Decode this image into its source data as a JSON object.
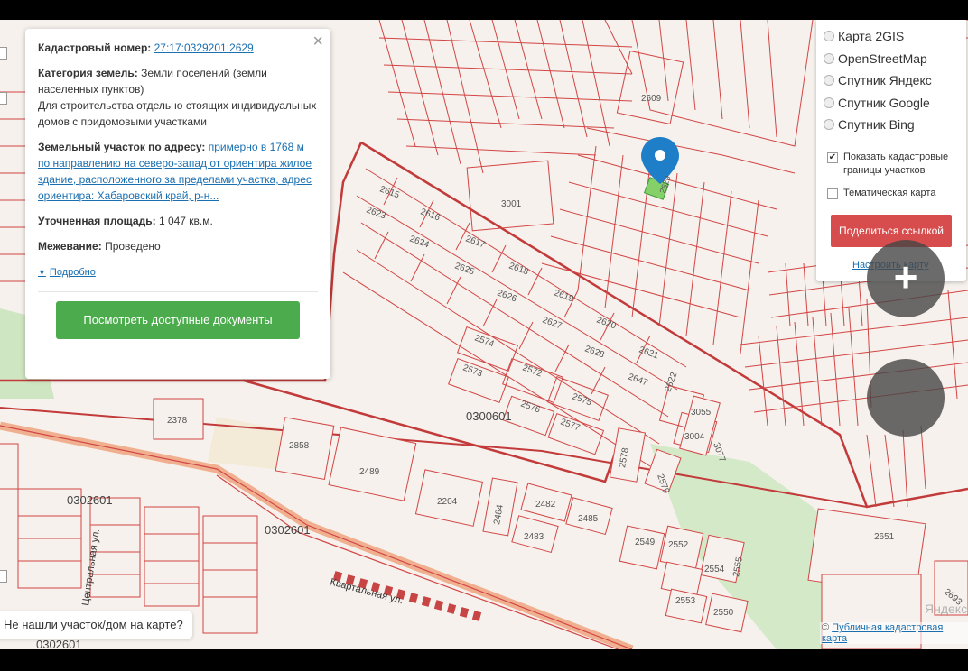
{
  "info_card": {
    "cadastral_label": "Кадастровый номер:",
    "cadastral_number": "27:17:0329201:2629",
    "category_label": "Категория земель:",
    "category_value": "Земли поселений (земли населенных пунктов)",
    "purpose": "Для строительства отдельно стоящих индивидуальных домов с придомовыми участками",
    "address_label": "Земельный участок по адресу:",
    "address_value": "примерно в 1768 м по направлению на северо-запад от ориентира жилое здание, расположенного за пределами участка, адрес ориентира: Хабаровский край, р-н...",
    "area_label": "Уточненная площадь:",
    "area_value": "1 047 кв.м.",
    "survey_label": "Межевание:",
    "survey_value": "Проведено",
    "more_label": "Подробно",
    "docs_button": "Посмотреть доступные документы",
    "close_glyph": "×"
  },
  "layers_panel": {
    "radios": [
      "Карта 2GIS",
      "OpenStreetMap",
      "Спутник Яндекс",
      "Спутник Google",
      "Спутник Bing"
    ],
    "show_borders_label": "Показать кадастровые границы участков",
    "show_borders_checked": true,
    "thematic_label": "Тематическая карта",
    "thematic_checked": false,
    "share_button": "Поделиться ссылкой",
    "setup_link": "Настроить карту"
  },
  "zoom": {
    "in_glyph": "+",
    "out_glyph": "−"
  },
  "not_found": "Не нашли участок/дом на карте?",
  "credit": {
    "prefix": "©",
    "link": "Публичная кадастровая карта"
  },
  "watermark": "Яндекс",
  "map": {
    "quarter_labels": [
      "0300601",
      "0302601",
      "0302601",
      "0302601"
    ],
    "street_labels": [
      "Центральная ул.",
      "Квартальная ул."
    ],
    "parcel_labels": [
      "2615",
      "2616",
      "2617",
      "2618",
      "2619",
      "2620",
      "2621",
      "2622",
      "2623",
      "2624",
      "2625",
      "2626",
      "2627",
      "2628",
      "2647",
      "2574",
      "2573",
      "2572",
      "2576",
      "2575",
      "2577",
      "2609",
      "3001",
      "2378",
      "2858",
      "2489",
      "2204",
      "2484",
      "2482",
      "2485",
      "2483",
      "2578",
      "2579",
      "3055",
      "3004",
      "3077",
      "2549",
      "2552",
      "2554",
      "2555",
      "2553",
      "2550",
      "2651",
      "2693",
      "2629"
    ],
    "colors": {
      "border": "#d24545",
      "thin": "#e08c8c",
      "green": "#cfe6c2",
      "road": "#f0b090",
      "pin": "#1e7ec8",
      "selected": "#86d06a"
    }
  }
}
